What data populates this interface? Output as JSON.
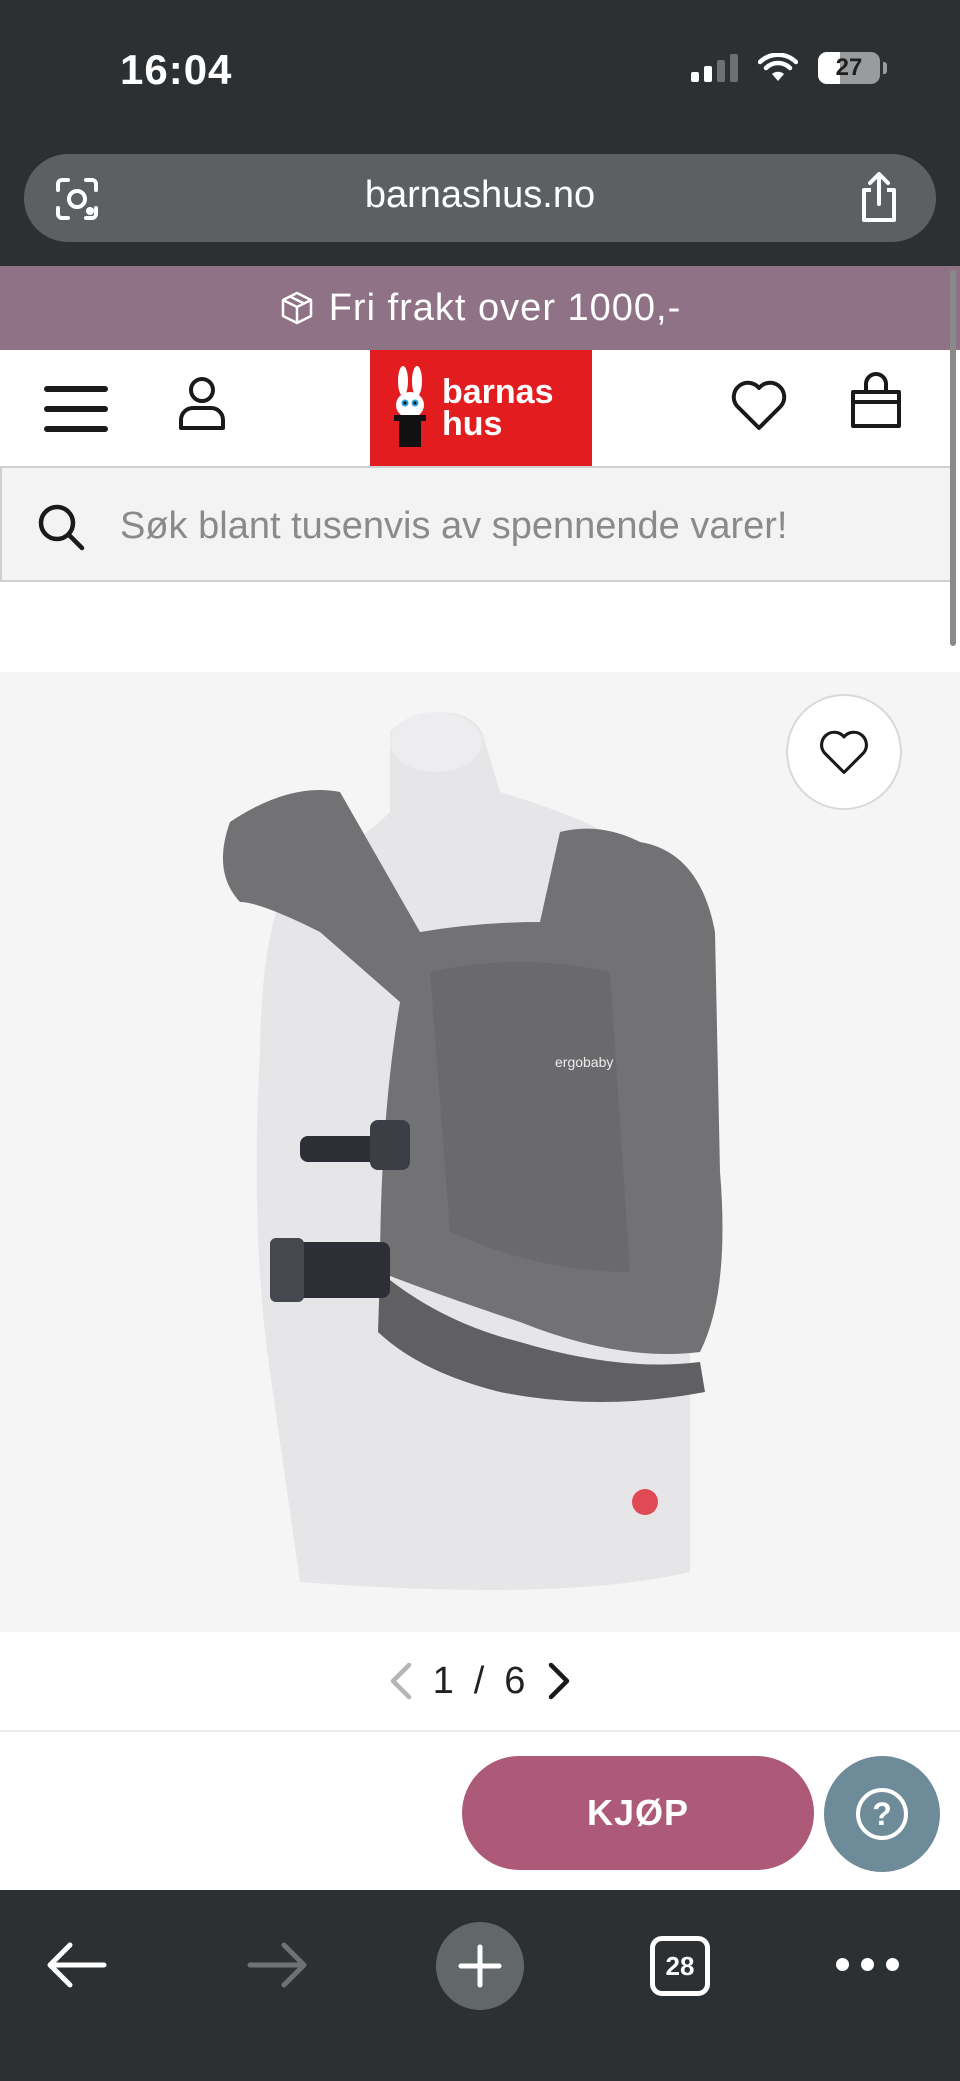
{
  "status_bar": {
    "time": "16:04",
    "battery": "27"
  },
  "browser": {
    "url": "barnashus.no",
    "tab_count": "28"
  },
  "promo": {
    "text": "Fri frakt over 1000,-"
  },
  "header": {
    "logo_line1": "barnas",
    "logo_line2": "hus"
  },
  "search": {
    "placeholder": "Søk blant tusenvis av spennende varer!"
  },
  "gallery": {
    "current": "1",
    "separator": "/",
    "total": "6"
  },
  "actions": {
    "buy_label": "KJØP",
    "help_label": "?"
  },
  "colors": {
    "promo_bg": "#8f7285",
    "logo_red": "#e31c1f",
    "buy_button": "#ad5a78",
    "help_button": "#6e8b99",
    "browser_chrome": "#2d3032"
  }
}
